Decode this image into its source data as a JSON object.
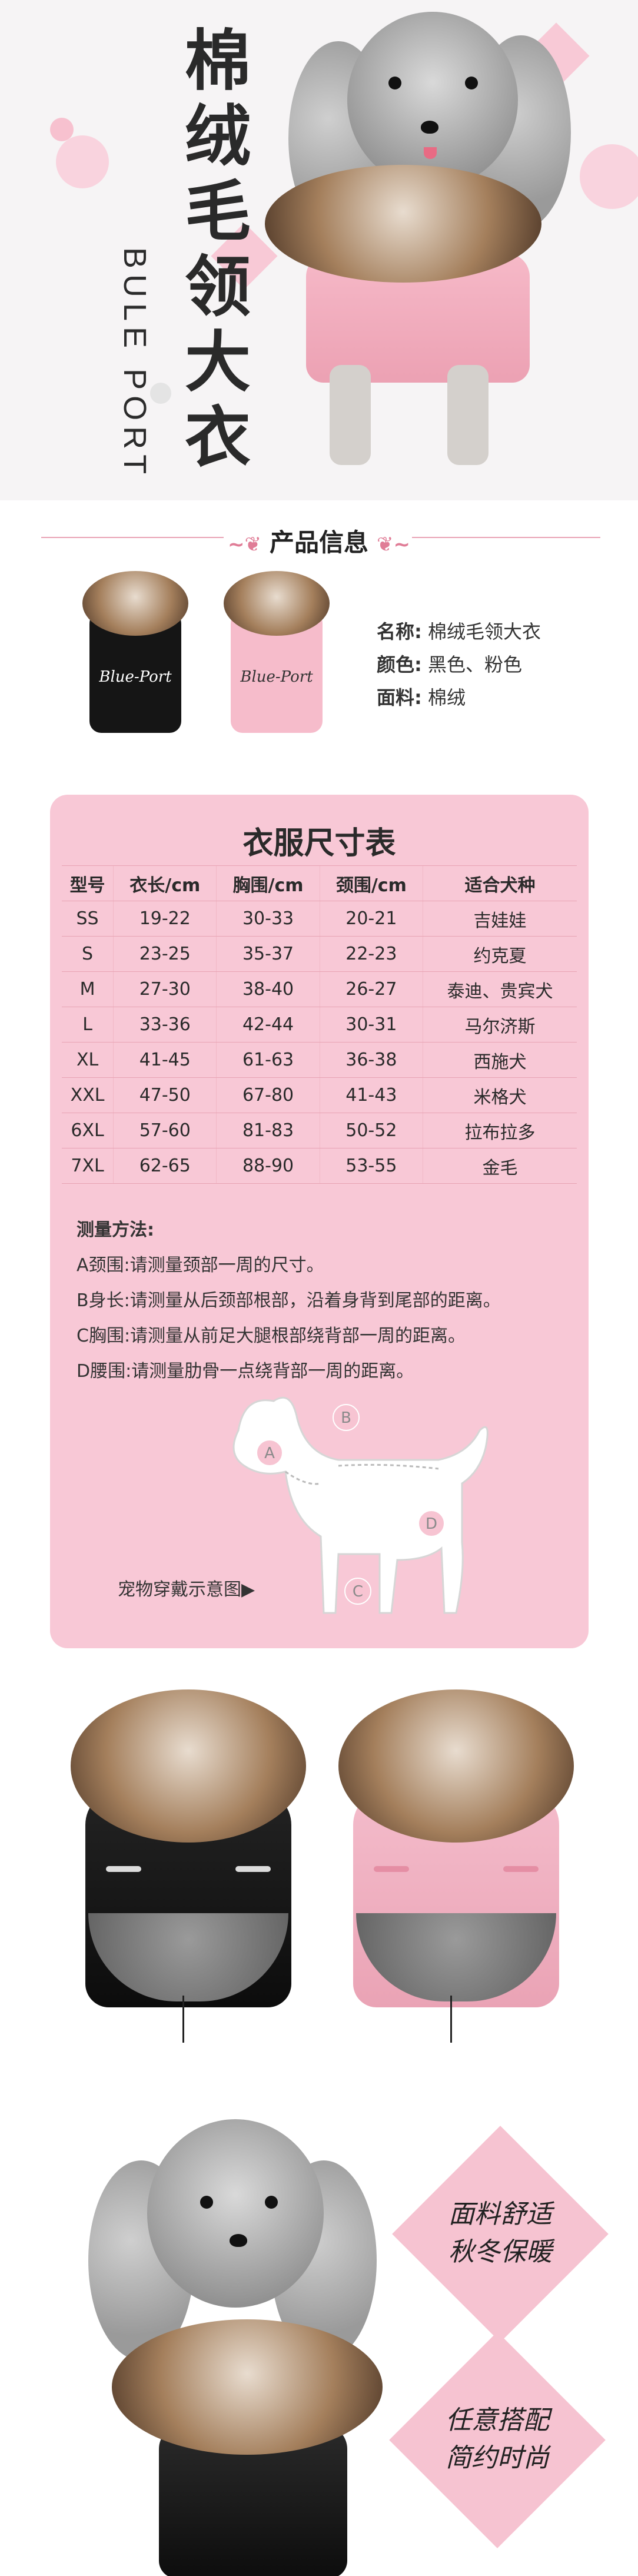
{
  "hero": {
    "title_cn": [
      "棉",
      "绒",
      "毛",
      "领",
      "大",
      "衣"
    ],
    "title_en": "BULE PORT"
  },
  "info": {
    "section_title": "产品信息",
    "coat_logo": "Blue-Port",
    "items": [
      {
        "key": "名称:",
        "value": "棉绒毛领大衣"
      },
      {
        "key": "颜色:",
        "value": "黑色、粉色"
      },
      {
        "key": "面料:",
        "value": "棉绒"
      }
    ]
  },
  "sizes": {
    "title": "衣服尺寸表",
    "headers": [
      "型号",
      "衣长/cm",
      "胸围/cm",
      "颈围/cm",
      "适合犬种"
    ],
    "rows": [
      [
        "SS",
        "19-22",
        "30-33",
        "20-21",
        "吉娃娃"
      ],
      [
        "S",
        "23-25",
        "35-37",
        "22-23",
        "约克夏"
      ],
      [
        "M",
        "27-30",
        "38-40",
        "26-27",
        "泰迪、贵宾犬"
      ],
      [
        "L",
        "33-36",
        "42-44",
        "30-31",
        "马尔济斯"
      ],
      [
        "XL",
        "41-45",
        "61-63",
        "36-38",
        "西施犬"
      ],
      [
        "XXL",
        "47-50",
        "67-80",
        "41-43",
        "米格犬"
      ],
      [
        "6XL",
        "57-60",
        "81-83",
        "50-52",
        "拉布拉多"
      ],
      [
        "7XL",
        "62-65",
        "88-90",
        "53-55",
        "金毛"
      ]
    ],
    "method_title": "测量方法:",
    "methods": [
      "A颈围:请测量颈部一周的尺寸。",
      "B身长:请测量从后颈部根部，沿着身背到尾部的距离。",
      "C胸围:请测量从前足大腿根部绕背部一周的距离。",
      "D腰围:请测量肋骨一点绕背部一周的距离。"
    ],
    "diagram_label": "宠物穿戴示意图▶",
    "badges": [
      "A",
      "B",
      "C",
      "D"
    ]
  },
  "callouts": [
    {
      "line1": "面料舒适",
      "line2": "秋冬保暖"
    },
    {
      "line1": "任意搭配",
      "line2": "简约时尚"
    }
  ],
  "colors": {
    "pink_panel": "#f8c8d6",
    "accent": "#e07c96",
    "coat_pink": "#f6b9c8",
    "coat_black": "#1a1a1a"
  }
}
